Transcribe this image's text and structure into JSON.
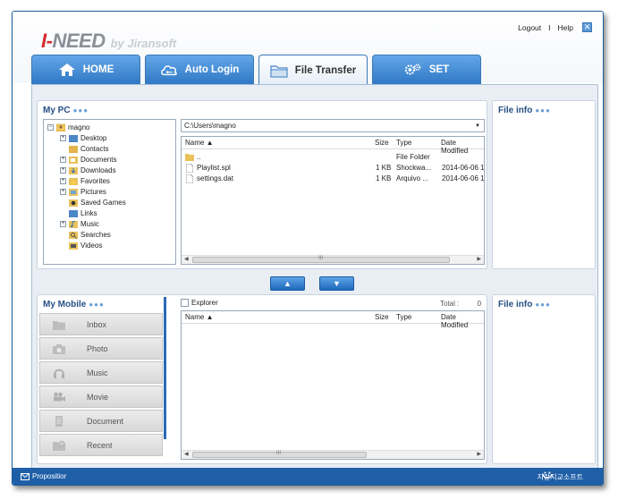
{
  "app": {
    "logo_prefix": "I-",
    "logo_main": "NEED",
    "logo_sub": "by Jiransoft"
  },
  "toplinks": {
    "logout": "Logout",
    "sep": "I",
    "help": "Help",
    "close": "✕"
  },
  "tabs": [
    {
      "label": "HOME",
      "icon": "home-icon"
    },
    {
      "label": "Auto Login",
      "icon": "cloud-key-icon"
    },
    {
      "label": "File Transfer",
      "icon": "folder-icon",
      "active": true
    },
    {
      "label": "SET",
      "icon": "gear-icon"
    }
  ],
  "mypc": {
    "title": "My PC",
    "tree_root": "magno",
    "tree": [
      {
        "label": "Desktop",
        "expandable": true
      },
      {
        "label": "Contacts",
        "expandable": false
      },
      {
        "label": "Documents",
        "expandable": true
      },
      {
        "label": "Downloads",
        "expandable": true
      },
      {
        "label": "Favorites",
        "expandable": true
      },
      {
        "label": "Pictures",
        "expandable": true
      },
      {
        "label": "Saved Games",
        "expandable": false
      },
      {
        "label": "Links",
        "expandable": false
      },
      {
        "label": "Music",
        "expandable": true
      },
      {
        "label": "Searches",
        "expandable": false
      },
      {
        "label": "Videos",
        "expandable": false
      }
    ],
    "path": "C:\\Users\\magno",
    "columns": {
      "name": "Name ▲",
      "size": "Size",
      "type": "Type",
      "date": "Date Modified"
    },
    "files": [
      {
        "name": "..",
        "size": "",
        "type": "File Folder",
        "date": "",
        "icon": "folder-icon"
      },
      {
        "name": "Playlist.spl",
        "size": "1 KB",
        "type": "Shockwa...",
        "date": "2014-06-06 1",
        "icon": "file-icon"
      },
      {
        "name": "settings.dat",
        "size": "1 KB",
        "type": "Arquivo ...",
        "date": "2014-06-06 1",
        "icon": "file-icon"
      }
    ],
    "scroll_label": "III"
  },
  "fileinfo_top": {
    "title": "File info"
  },
  "transfer": {
    "up": "▲",
    "down": "▼"
  },
  "mymobile": {
    "title": "My Mobile",
    "explorer_label": "Explorer",
    "total_label": "Total :",
    "total_value": "0",
    "nav": [
      {
        "label": "Inbox",
        "icon": "folder-icon"
      },
      {
        "label": "Photo",
        "icon": "camera-icon"
      },
      {
        "label": "Music",
        "icon": "headphones-icon"
      },
      {
        "label": "Movie",
        "icon": "movie-camera-icon"
      },
      {
        "label": "Document",
        "icon": "document-icon"
      },
      {
        "label": "Recent",
        "icon": "recent-folder-icon"
      }
    ],
    "columns": {
      "name": "Name ▲",
      "size": "Size",
      "type": "Type",
      "date": "Date Modified"
    },
    "scroll_label": "III"
  },
  "fileinfo_bottom": {
    "title": "File info"
  },
  "statusbar": {
    "left": "Propositior",
    "right": "지란지교소프트"
  },
  "colors": {
    "accent": "#2f78c4",
    "title": "#264f86",
    "statusbar": "#1f5fa8"
  }
}
